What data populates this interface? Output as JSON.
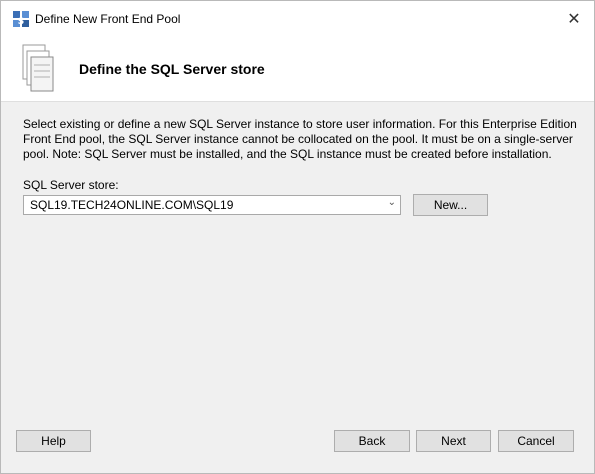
{
  "window": {
    "title": "Define New Front End Pool",
    "close_glyph": "✕",
    "app_icon": "lync-topology-icon"
  },
  "header": {
    "title": "Define the SQL Server store",
    "icon": "sql-server-stack-icon"
  },
  "body": {
    "description": "Select existing or define a new SQL Server instance to store user information.  For this Enterprise Edition Front End pool, the SQL Server instance cannot be collocated on the pool. It must be on a single-server pool.  Note: SQL Server must be installed, and the SQL instance must be created before installation.",
    "store_label": "SQL Server store:",
    "store_value": "SQL19.TECH24ONLINE.COM\\SQL19",
    "dropdown_glyph": "⌄",
    "new_button": "New..."
  },
  "footer": {
    "help_button": "Help",
    "back_button": "Back",
    "next_button": "Next",
    "cancel_button": "Cancel"
  }
}
